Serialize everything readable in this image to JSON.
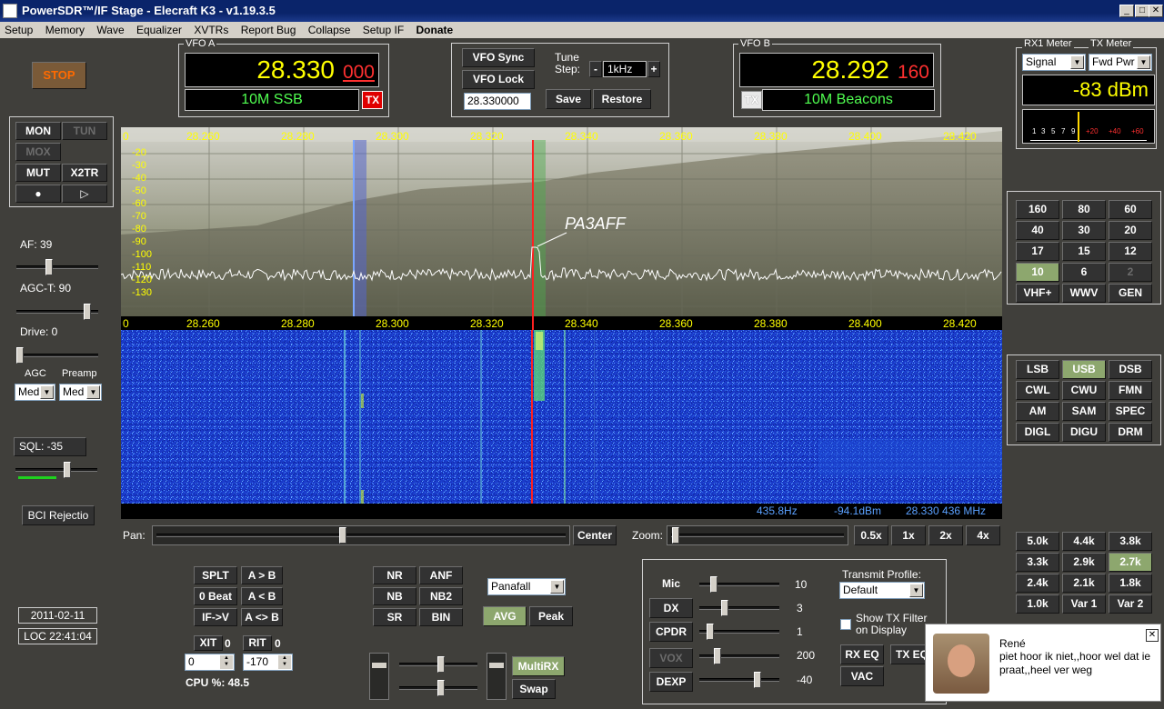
{
  "title": "PowerSDR™/IF Stage - Elecraft K3 - v1.19.3.5",
  "menu": [
    "Setup",
    "Memory",
    "Wave",
    "Equalizer",
    "XVTRs",
    "Report Bug",
    "Collapse",
    "Setup IF",
    "Donate"
  ],
  "stop_label": "STOP",
  "vfo_a": {
    "label": "VFO A",
    "freq_main": "28.330",
    "freq_sub": "000",
    "mode": "10M SSB",
    "tx": "TX"
  },
  "vfo_b": {
    "label": "VFO B",
    "freq_main": "28.292",
    "freq_sub": "160",
    "mode": "10M Beacons",
    "tx": "TX"
  },
  "sync": {
    "vfo_sync": "VFO Sync",
    "vfo_lock": "VFO Lock",
    "tune_label": "Tune\nStep:",
    "tune_minus": "-",
    "tune_step": "1kHz",
    "tune_plus": "+",
    "freq_field": "28.330000",
    "save": "Save",
    "restore": "Restore"
  },
  "meter": {
    "rx_label": "RX1 Meter",
    "tx_label": "TX Meter",
    "rx_sel": "Signal",
    "tx_sel": "Fwd Pwr",
    "reading": "-83 dBm",
    "scale": [
      "1",
      "3",
      "5",
      "7",
      "9",
      "+20",
      "+40",
      "+60"
    ]
  },
  "left": {
    "mon": "MON",
    "tun": "TUN",
    "mox": "MOX",
    "mut": "MUT",
    "x2tr": "X2TR",
    "af": "AF:  39",
    "agct": "AGC-T:  90",
    "drive": "Drive:  0",
    "agc": "AGC",
    "preamp": "Preamp",
    "agc_val": "Med",
    "preamp_val": "Med",
    "sql": "SQL:  -35",
    "bci": "BCI Rejectio",
    "date": "2011-02-11",
    "time": "LOC 22:41:04",
    "af_pos": 0.39,
    "agct_pos": 0.9,
    "drive_pos": 0.0,
    "sql_pos": 0.65
  },
  "spectrum": {
    "freq_ticks": [
      "0",
      "28.260",
      "28.280",
      "28.300",
      "28.320",
      "28.340",
      "28.360",
      "28.380",
      "28.400",
      "28.420"
    ],
    "db_ticks": [
      "-20",
      "-30",
      "-40",
      "-50",
      "-60",
      "-70",
      "-80",
      "-90",
      "-100",
      "-110",
      "-120",
      "-130"
    ],
    "callsign": "PA3AFF",
    "cursor_hz": "435.8Hz",
    "cursor_dbm": "-94.1dBm",
    "cursor_mhz": "28.330 436 MHz"
  },
  "pan": {
    "pan_label": "Pan:",
    "center": "Center",
    "zoom_label": "Zoom:",
    "zooms": [
      "0.5x",
      "1x",
      "2x",
      "4x"
    ]
  },
  "bands": [
    "160",
    "80",
    "60",
    "40",
    "30",
    "20",
    "17",
    "15",
    "12",
    "10",
    "6",
    "2",
    "VHF+",
    "WWV",
    "GEN"
  ],
  "modes": [
    "LSB",
    "USB",
    "DSB",
    "CWL",
    "CWU",
    "FMN",
    "AM",
    "SAM",
    "SPEC",
    "DIGL",
    "DIGU",
    "DRM"
  ],
  "filters": [
    "5.0k",
    "4.4k",
    "3.8k",
    "3.3k",
    "2.9k",
    "2.7k",
    "2.4k",
    "2.1k",
    "1.8k",
    "1.0k",
    "Var 1",
    "Var 2"
  ],
  "split": {
    "splt": "SPLT",
    "atob": "A > B",
    "zerobeat": "0 Beat",
    "atob2": "A < B",
    "ifv": "IF->V",
    "aswap": "A <> B",
    "xit": "XIT",
    "xit_val": "0",
    "rit": "RIT",
    "rit_val": "0",
    "xit_spin": "0",
    "rit_spin": "-170",
    "cpu": "CPU %:  48.5"
  },
  "dsp": {
    "nr": "NR",
    "anf": "ANF",
    "nb": "NB",
    "nb2": "NB2",
    "sr": "SR",
    "bin": "BIN",
    "display_mode": "Panafall",
    "avg": "AVG",
    "peak": "Peak",
    "multirx": "MultiRX",
    "swap": "Swap"
  },
  "tx": {
    "mic": "Mic",
    "mic_val": "10",
    "dx": "DX",
    "dx_val": "3",
    "cpdr": "CPDR",
    "cpdr_val": "1",
    "vox": "VOX",
    "vox_val": "200",
    "dexp": "DEXP",
    "dexp_val": "-40",
    "profile_label": "Transmit Profile:",
    "profile": "Default",
    "show_filter": "Show TX Filter\non Display",
    "rxeq": "RX EQ",
    "txeq": "TX EQ",
    "vac": "VAC"
  },
  "toast": {
    "name": "René",
    "message": "piet hoor ik niet,,hoor wel dat ie praat,,heel ver weg"
  },
  "colors": {
    "accent_green": "#8da76e",
    "vfo_yellow": "#ffff00",
    "stop_orange": "#ff6a00",
    "waterfall_blue": "#1638c8"
  }
}
